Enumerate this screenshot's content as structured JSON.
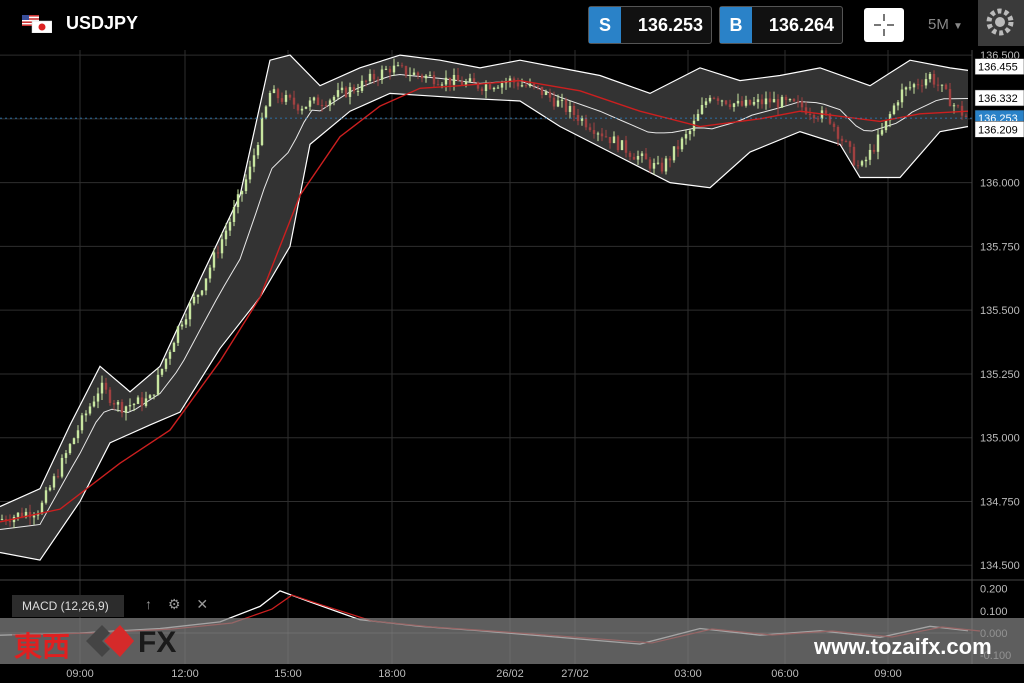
{
  "header": {
    "symbol": "USDJPY",
    "sell_tag": "S",
    "sell_price": "136.253",
    "buy_tag": "B",
    "buy_price": "136.264",
    "timeframe": "5M"
  },
  "macd": {
    "label": "MACD (12,26,9)",
    "ticks": [
      "0.200",
      "0.100",
      "0.000",
      "-0.100"
    ]
  },
  "watermark": {
    "kanji": "東西",
    "fx": "FX",
    "site": "www.tozaifx.com"
  },
  "colors": {
    "accent": "#2a82c8",
    "ma_line": "#cc1f1f",
    "band": "#ffffff",
    "grid": "#2e2e2e"
  },
  "chart_data": {
    "type": "line",
    "subtype": "candlestick with Bollinger Bands and moving average",
    "ylim": [
      134.45,
      136.52
    ],
    "yticks": [
      134.5,
      134.75,
      135.0,
      135.25,
      135.5,
      135.75,
      136.0,
      136.25,
      136.5
    ],
    "ytick_labels": [
      "134.500",
      "134.750",
      "135.000",
      "135.250",
      "135.500",
      "135.750",
      "136.000",
      "136.250",
      "136.500"
    ],
    "xtick_labels": [
      "09:00",
      "12:00",
      "15:00",
      "18:00",
      "26/02",
      "27/02",
      "03:00",
      "06:00",
      "09:00"
    ],
    "price_labels": [
      {
        "label": "136.455",
        "value": 136.455,
        "style": "white"
      },
      {
        "label": "136.332",
        "value": 136.332,
        "style": "white"
      },
      {
        "label": "136.253",
        "value": 136.253,
        "style": "blue"
      },
      {
        "label": "136.209",
        "value": 136.209,
        "style": "white"
      }
    ],
    "grid": true,
    "series": [],
    "close_points": [
      [
        0,
        134.68
      ],
      [
        40,
        134.72
      ],
      [
        80,
        135.05
      ],
      [
        100,
        135.2
      ],
      [
        120,
        135.12
      ],
      [
        150,
        135.15
      ],
      [
        180,
        135.45
      ],
      [
        200,
        135.58
      ],
      [
        230,
        135.85
      ],
      [
        250,
        136.05
      ],
      [
        270,
        136.35
      ],
      [
        300,
        136.3
      ],
      [
        330,
        136.33
      ],
      [
        360,
        136.38
      ],
      [
        390,
        136.45
      ],
      [
        420,
        136.42
      ],
      [
        450,
        136.4
      ],
      [
        480,
        136.38
      ],
      [
        510,
        136.4
      ],
      [
        540,
        136.36
      ],
      [
        570,
        136.28
      ],
      [
        600,
        136.2
      ],
      [
        630,
        136.12
      ],
      [
        660,
        136.05
      ],
      [
        690,
        136.2
      ],
      [
        710,
        136.35
      ],
      [
        740,
        136.3
      ],
      [
        770,
        136.32
      ],
      [
        800,
        136.3
      ],
      [
        830,
        136.25
      ],
      [
        860,
        136.05
      ],
      [
        880,
        136.18
      ],
      [
        900,
        136.35
      ],
      [
        930,
        136.42
      ],
      [
        955,
        136.3
      ],
      [
        968,
        136.25
      ]
    ],
    "ma_points": [
      [
        0,
        134.67
      ],
      [
        60,
        134.72
      ],
      [
        120,
        134.9
      ],
      [
        170,
        135.03
      ],
      [
        220,
        135.3
      ],
      [
        260,
        135.55
      ],
      [
        300,
        135.95
      ],
      [
        340,
        136.18
      ],
      [
        380,
        136.3
      ],
      [
        420,
        136.37
      ],
      [
        460,
        136.38
      ],
      [
        520,
        136.4
      ],
      [
        580,
        136.36
      ],
      [
        640,
        136.28
      ],
      [
        700,
        136.22
      ],
      [
        760,
        136.25
      ],
      [
        800,
        136.28
      ],
      [
        840,
        136.26
      ],
      [
        880,
        136.24
      ],
      [
        920,
        136.27
      ],
      [
        968,
        136.28
      ]
    ],
    "upper_points": [
      [
        0,
        134.73
      ],
      [
        40,
        134.8
      ],
      [
        70,
        135.05
      ],
      [
        100,
        135.28
      ],
      [
        130,
        135.18
      ],
      [
        160,
        135.28
      ],
      [
        200,
        135.62
      ],
      [
        240,
        135.95
      ],
      [
        270,
        136.48
      ],
      [
        290,
        136.5
      ],
      [
        320,
        136.38
      ],
      [
        360,
        136.45
      ],
      [
        400,
        136.5
      ],
      [
        440,
        136.48
      ],
      [
        480,
        136.45
      ],
      [
        520,
        136.48
      ],
      [
        560,
        136.45
      ],
      [
        600,
        136.42
      ],
      [
        650,
        136.35
      ],
      [
        700,
        136.45
      ],
      [
        740,
        136.4
      ],
      [
        780,
        136.42
      ],
      [
        820,
        136.45
      ],
      [
        870,
        136.38
      ],
      [
        910,
        136.48
      ],
      [
        950,
        136.45
      ],
      [
        968,
        136.44
      ]
    ],
    "lower_points": [
      [
        0,
        134.55
      ],
      [
        40,
        134.52
      ],
      [
        80,
        134.75
      ],
      [
        110,
        134.98
      ],
      [
        150,
        135.05
      ],
      [
        180,
        135.1
      ],
      [
        220,
        135.35
      ],
      [
        260,
        135.55
      ],
      [
        290,
        135.75
      ],
      [
        310,
        136.15
      ],
      [
        350,
        136.28
      ],
      [
        390,
        136.35
      ],
      [
        430,
        136.34
      ],
      [
        470,
        136.33
      ],
      [
        520,
        136.32
      ],
      [
        560,
        136.22
      ],
      [
        620,
        136.1
      ],
      [
        670,
        136.0
      ],
      [
        710,
        135.98
      ],
      [
        750,
        136.12
      ],
      [
        800,
        136.2
      ],
      [
        840,
        136.15
      ],
      [
        860,
        136.02
      ],
      [
        900,
        136.02
      ],
      [
        940,
        136.2
      ],
      [
        968,
        136.22
      ]
    ],
    "macd_values": [
      [
        0,
        -0.01
      ],
      [
        80,
        0.0
      ],
      [
        160,
        0.02
      ],
      [
        220,
        0.05
      ],
      [
        260,
        0.12
      ],
      [
        280,
        0.19
      ],
      [
        310,
        0.14
      ],
      [
        360,
        0.06
      ],
      [
        420,
        0.03
      ],
      [
        480,
        0.01
      ],
      [
        560,
        -0.02
      ],
      [
        640,
        -0.05
      ],
      [
        700,
        0.02
      ],
      [
        760,
        -0.01
      ],
      [
        820,
        0.01
      ],
      [
        880,
        -0.02
      ],
      [
        930,
        0.03
      ],
      [
        968,
        0.01
      ]
    ]
  }
}
